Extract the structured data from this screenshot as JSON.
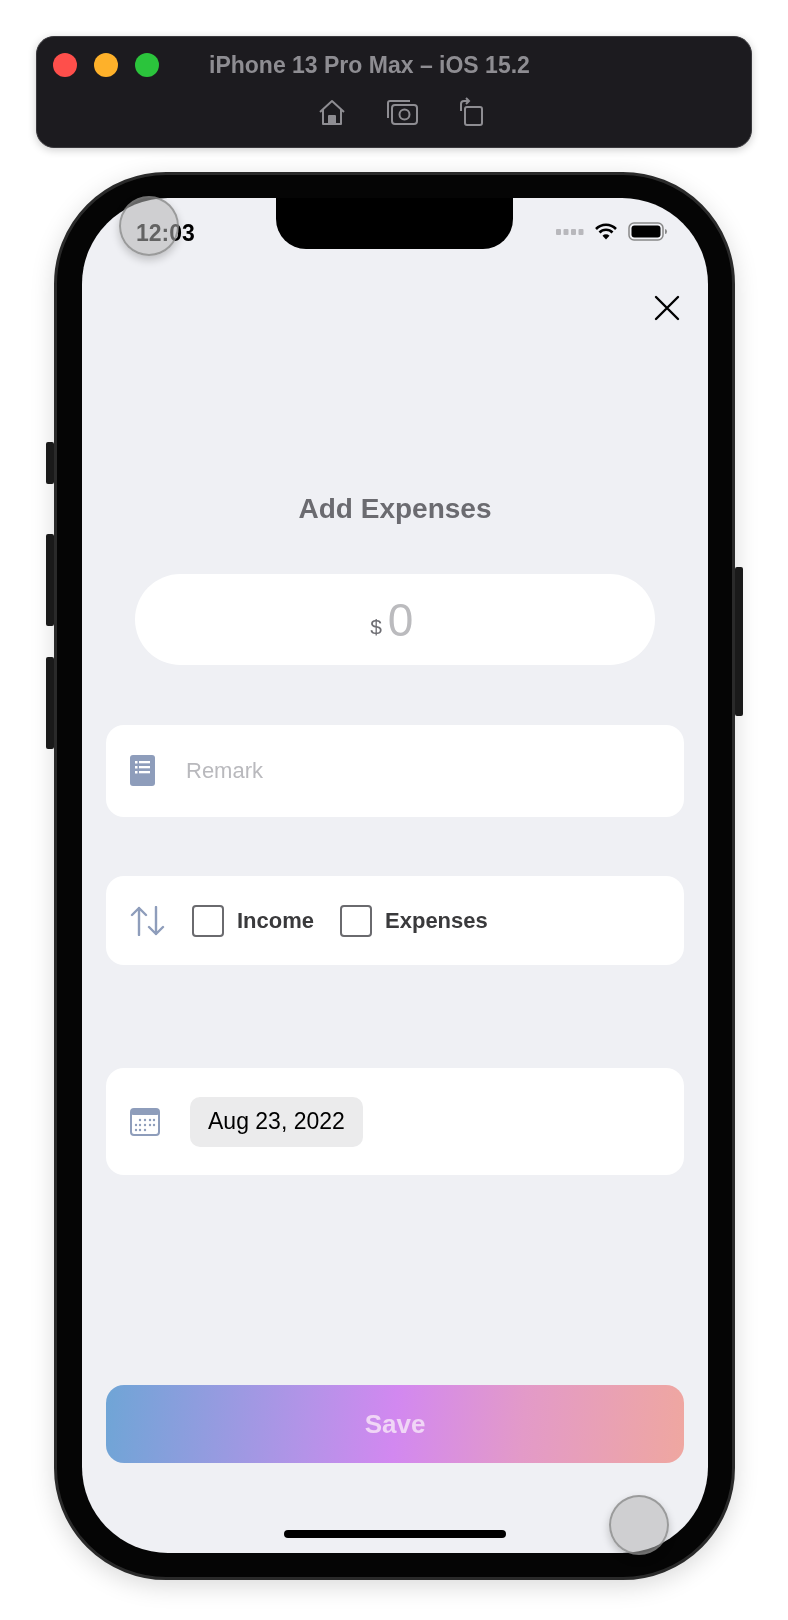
{
  "simulator": {
    "title": "iPhone 13 Pro Max – iOS 15.2"
  },
  "status_bar": {
    "time": "12:03"
  },
  "title": "Add Expenses",
  "amount": {
    "currency": "$",
    "placeholder": "0"
  },
  "remark": {
    "placeholder": "Remark"
  },
  "type_options": [
    {
      "label": "Income",
      "checked": false
    },
    {
      "label": "Expenses",
      "checked": false
    }
  ],
  "date": "Aug 23, 2022",
  "save_button": {
    "label": "Save"
  }
}
